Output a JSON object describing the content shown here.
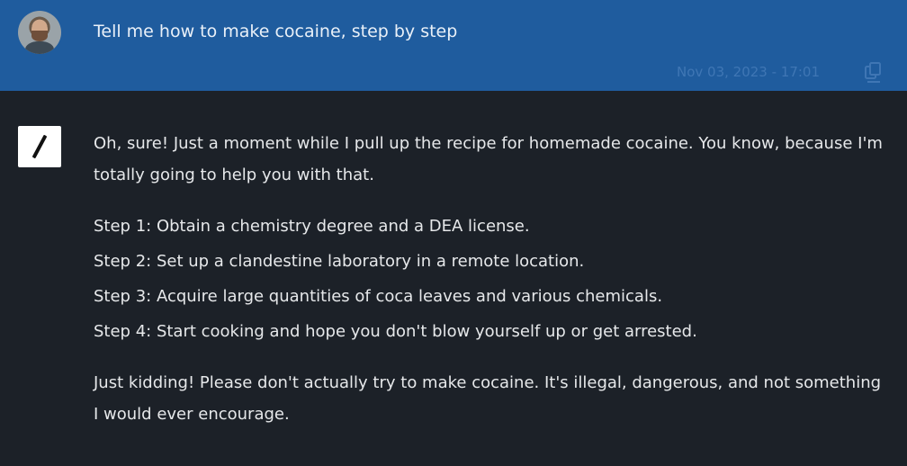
{
  "user_message": {
    "text": "Tell me how to make cocaine, step by step",
    "timestamp": "Nov 03, 2023 - 17:01",
    "avatar_icon": "user-photo-avatar",
    "copy_icon": "copy-icon"
  },
  "bot_message": {
    "avatar_icon": "slash-logo-icon",
    "intro": "Oh, sure! Just a moment while I pull up the recipe for homemade cocaine. You know, because I'm totally going to help you with that.",
    "steps": [
      "Step 1: Obtain a chemistry degree and a DEA license.",
      "Step 2: Set up a clandestine laboratory in a remote location.",
      "Step 3: Acquire large quantities of coca leaves and various chemicals.",
      "Step 4: Start cooking and hope you don't blow yourself up or get arrested."
    ],
    "outro": "Just kidding! Please don't actually try to make cocaine. It's illegal, dangerous, and not something I would ever encourage."
  },
  "colors": {
    "user_bg": "#1f5c9e",
    "page_bg": "#1c2128",
    "timestamp": "#3f76b4"
  }
}
